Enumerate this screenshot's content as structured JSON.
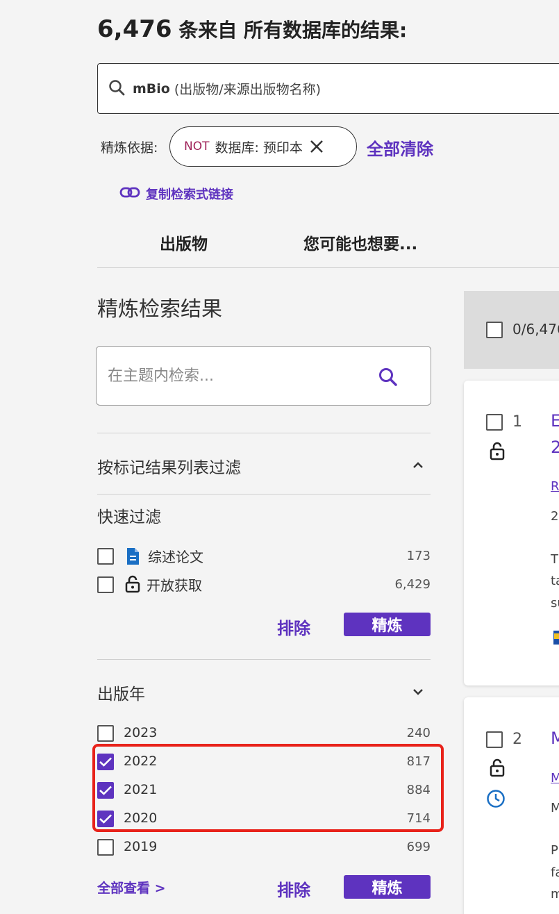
{
  "header": {
    "count": "6,476",
    "rest": " 条来自 所有数据库的结果:"
  },
  "query": {
    "term": "mBio",
    "field": "(出版物/来源出版物名称)"
  },
  "refine": {
    "label": "精炼依据:",
    "chip_not": "NOT",
    "chip_text": "数据库: 预印本",
    "clear_all": "全部清除"
  },
  "copy_link": "复制检索式链接",
  "tabs": {
    "publications": "出版物",
    "also_like": "您可能也想要..."
  },
  "sidebar": {
    "title": "精炼检索结果",
    "topic_search_placeholder": "在主题内检索...",
    "marked_list_filter": "按标记结果列表过滤",
    "quick_filter": {
      "title": "快速过滤",
      "items": [
        {
          "label": "综述论文",
          "count": "173",
          "icon": "document-icon",
          "checked": false
        },
        {
          "label": "开放获取",
          "count": "6,429",
          "icon": "unlock-icon",
          "checked": false
        }
      ],
      "exclude": "排除",
      "refine": "精炼"
    },
    "pub_year": {
      "title": "出版年",
      "items": [
        {
          "label": "2023",
          "count": "240",
          "checked": false
        },
        {
          "label": "2022",
          "count": "817",
          "checked": true
        },
        {
          "label": "2021",
          "count": "884",
          "checked": true
        },
        {
          "label": "2020",
          "count": "714",
          "checked": true
        },
        {
          "label": "2019",
          "count": "699",
          "checked": false
        }
      ],
      "see_all": "全部查看 >",
      "exclude": "排除",
      "refine": "精炼"
    }
  },
  "results": {
    "selection": "0/6,476",
    "items": [
      {
        "num": "1",
        "title_frag": "E",
        "title_frag2": "2",
        "author_frag": "R",
        "date_frag": "2(",
        "abstract": [
          "T",
          "ta",
          "su"
        ]
      },
      {
        "num": "2",
        "title_frag": "M",
        "author_frag": "M",
        "date_frag": "M",
        "abstract": [
          "P",
          "fa",
          "m"
        ]
      }
    ]
  },
  "colors": {
    "accent": "#5e33bf",
    "highlight": "#e8221a",
    "not_label": "#a0245a",
    "doc_icon": "#1a6fc4"
  }
}
